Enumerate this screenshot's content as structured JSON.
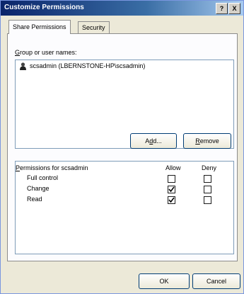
{
  "window": {
    "title": "Customize Permissions"
  },
  "titlebar": {
    "help": "?",
    "close": "X"
  },
  "tabs": [
    {
      "label": "Share Permissions",
      "active": true
    },
    {
      "label": "Security",
      "active": false
    }
  ],
  "group_section": {
    "label_prefix": "",
    "label_mnemonic": "G",
    "label_rest": "roup or user names:",
    "users": [
      {
        "name": "scsadmin (LBERNSTONE-HP\\scsadmin)",
        "icon": "user-icon"
      }
    ]
  },
  "buttons": {
    "add_mnemonic": "d",
    "add_pre": "A",
    "add_post": "d...",
    "remove_mnemonic": "R",
    "remove_rest": "emove",
    "ok": "OK",
    "cancel": "Cancel"
  },
  "permissions": {
    "header_mnemonic": "P",
    "header_rest": "ermissions for scsadmin",
    "allow_label": "Allow",
    "deny_label": "Deny",
    "rows": [
      {
        "name": "Full control",
        "allow": false,
        "deny": false
      },
      {
        "name": "Change",
        "allow": true,
        "deny": false
      },
      {
        "name": "Read",
        "allow": true,
        "deny": false
      }
    ]
  }
}
